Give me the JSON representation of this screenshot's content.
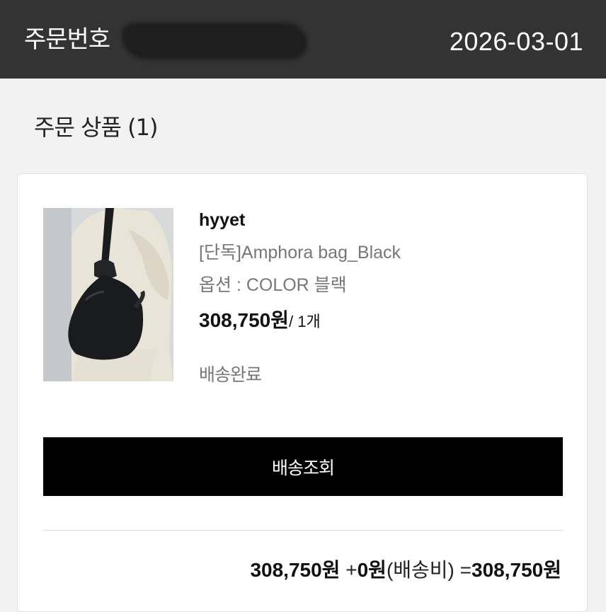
{
  "header": {
    "order_label": "주문번호",
    "order_date": "2026-03-01"
  },
  "section": {
    "title": "주문 상품 (1)"
  },
  "product": {
    "brand": "hyyet",
    "name": "[단독]Amphora bag_Black",
    "option": "옵션 : COLOR 블랙",
    "price": "308,750원",
    "quantity": "/ 1개",
    "status": "배송완료"
  },
  "actions": {
    "track_label": "배송조회"
  },
  "summary": {
    "subtotal": "308,750원",
    "plus": "+",
    "shipping_amount": "0원",
    "shipping_label": "(배송비)",
    "equals": "=",
    "total": "308,750원"
  },
  "colors": {
    "header_bg": "#333333",
    "button_bg": "#000000",
    "muted_text": "#777777"
  }
}
